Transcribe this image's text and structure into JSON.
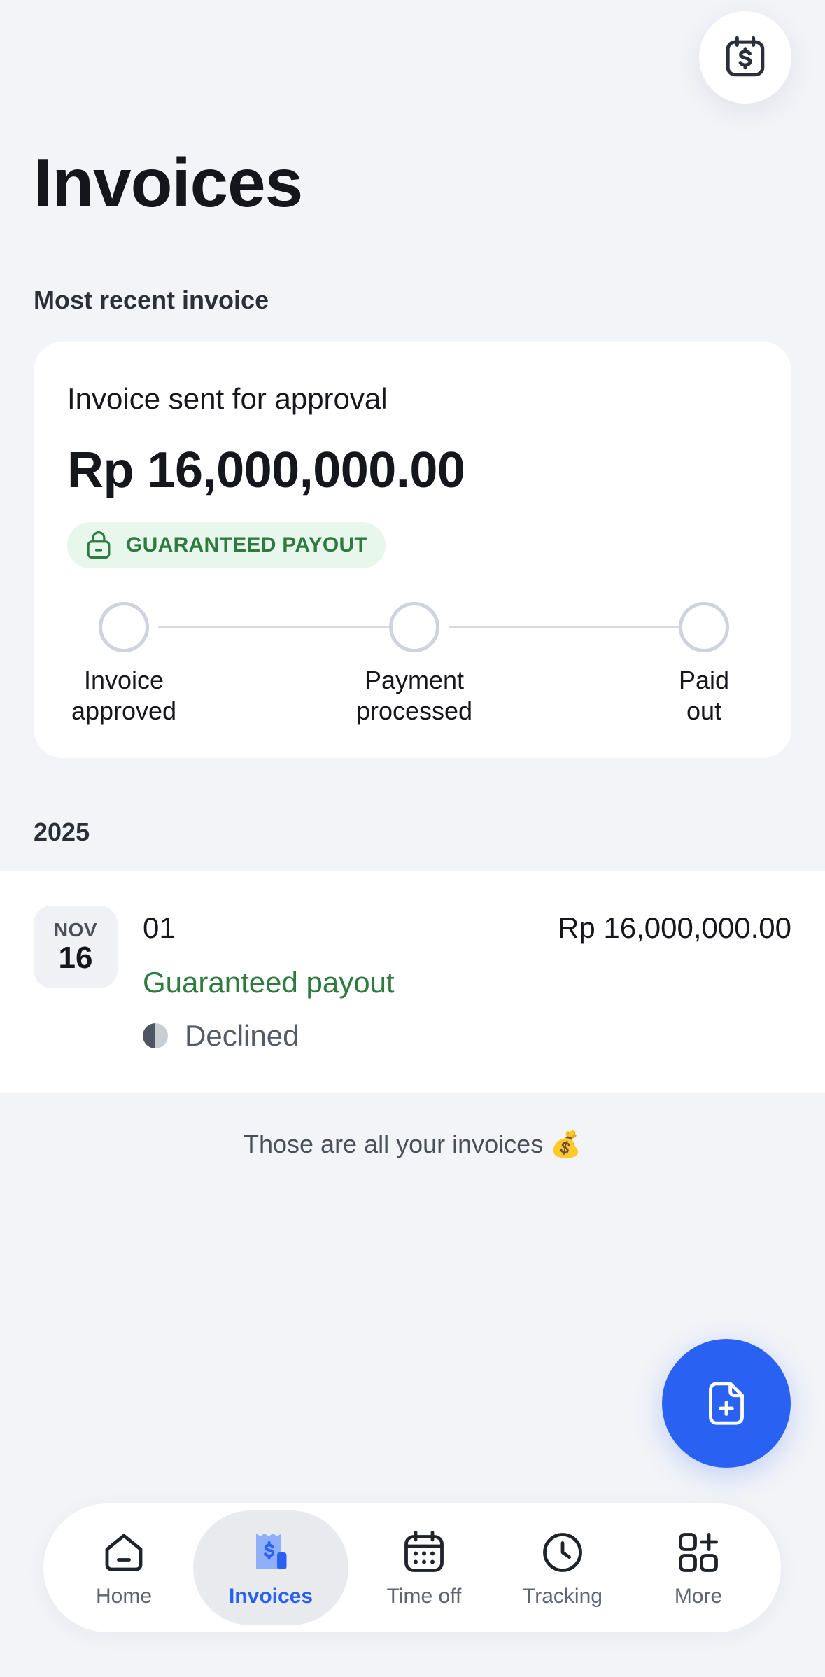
{
  "header": {
    "title": "Invoices",
    "action_icon": "invoice-dollar-icon"
  },
  "recent": {
    "section_label": "Most recent invoice",
    "status": "Invoice sent for approval",
    "amount": "Rp 16,000,000.00",
    "badge": "GUARANTEED PAYOUT",
    "steps": [
      {
        "line1": "Invoice",
        "line2": "approved"
      },
      {
        "line1": "Payment",
        "line2": "processed"
      },
      {
        "line1": "Paid",
        "line2": "out"
      }
    ]
  },
  "list": {
    "year": "2025",
    "invoices": [
      {
        "month": "NOV",
        "day": "16",
        "number": "01",
        "amount": "Rp 16,000,000.00",
        "payout": "Guaranteed payout",
        "status": "Declined"
      }
    ],
    "end_note": "Those are all your invoices 💰"
  },
  "fab": {
    "icon": "new-document-icon"
  },
  "tabbar": {
    "items": [
      {
        "label": "Home",
        "icon": "home-icon"
      },
      {
        "label": "Invoices",
        "icon": "invoices-icon",
        "active": true
      },
      {
        "label": "Time off",
        "icon": "calendar-icon"
      },
      {
        "label": "Tracking",
        "icon": "clock-icon"
      },
      {
        "label": "More",
        "icon": "grid-plus-icon"
      }
    ]
  },
  "colors": {
    "accent": "#2962f2",
    "success": "#2f7a3e",
    "background": "#f3f4f8"
  }
}
